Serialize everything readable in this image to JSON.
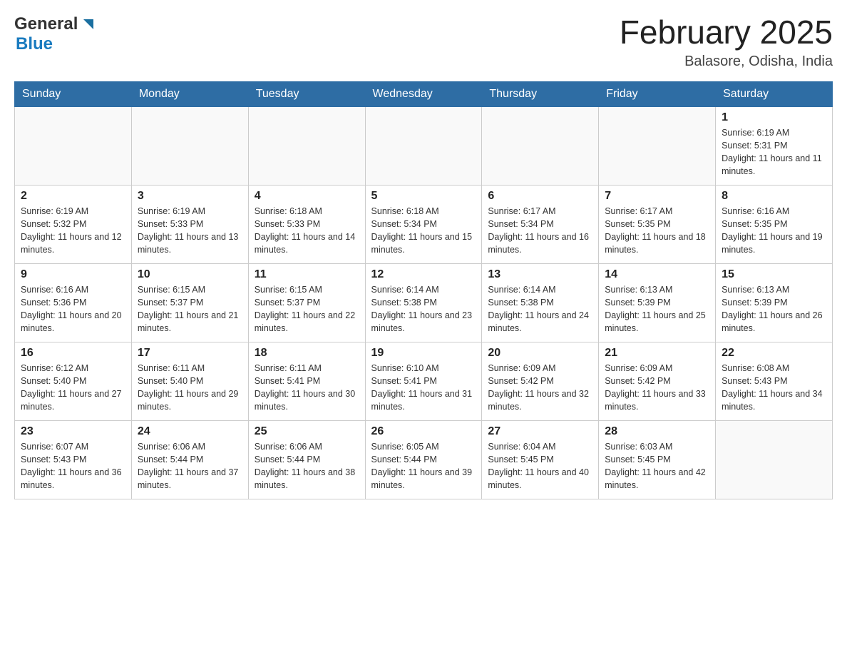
{
  "header": {
    "logo_general": "General",
    "logo_blue": "Blue",
    "month_title": "February 2025",
    "location": "Balasore, Odisha, India"
  },
  "days_of_week": [
    "Sunday",
    "Monday",
    "Tuesday",
    "Wednesday",
    "Thursday",
    "Friday",
    "Saturday"
  ],
  "weeks": [
    {
      "days": [
        {
          "number": "",
          "info": ""
        },
        {
          "number": "",
          "info": ""
        },
        {
          "number": "",
          "info": ""
        },
        {
          "number": "",
          "info": ""
        },
        {
          "number": "",
          "info": ""
        },
        {
          "number": "",
          "info": ""
        },
        {
          "number": "1",
          "info": "Sunrise: 6:19 AM\nSunset: 5:31 PM\nDaylight: 11 hours and 11 minutes."
        }
      ]
    },
    {
      "days": [
        {
          "number": "2",
          "info": "Sunrise: 6:19 AM\nSunset: 5:32 PM\nDaylight: 11 hours and 12 minutes."
        },
        {
          "number": "3",
          "info": "Sunrise: 6:19 AM\nSunset: 5:33 PM\nDaylight: 11 hours and 13 minutes."
        },
        {
          "number": "4",
          "info": "Sunrise: 6:18 AM\nSunset: 5:33 PM\nDaylight: 11 hours and 14 minutes."
        },
        {
          "number": "5",
          "info": "Sunrise: 6:18 AM\nSunset: 5:34 PM\nDaylight: 11 hours and 15 minutes."
        },
        {
          "number": "6",
          "info": "Sunrise: 6:17 AM\nSunset: 5:34 PM\nDaylight: 11 hours and 16 minutes."
        },
        {
          "number": "7",
          "info": "Sunrise: 6:17 AM\nSunset: 5:35 PM\nDaylight: 11 hours and 18 minutes."
        },
        {
          "number": "8",
          "info": "Sunrise: 6:16 AM\nSunset: 5:35 PM\nDaylight: 11 hours and 19 minutes."
        }
      ]
    },
    {
      "days": [
        {
          "number": "9",
          "info": "Sunrise: 6:16 AM\nSunset: 5:36 PM\nDaylight: 11 hours and 20 minutes."
        },
        {
          "number": "10",
          "info": "Sunrise: 6:15 AM\nSunset: 5:37 PM\nDaylight: 11 hours and 21 minutes."
        },
        {
          "number": "11",
          "info": "Sunrise: 6:15 AM\nSunset: 5:37 PM\nDaylight: 11 hours and 22 minutes."
        },
        {
          "number": "12",
          "info": "Sunrise: 6:14 AM\nSunset: 5:38 PM\nDaylight: 11 hours and 23 minutes."
        },
        {
          "number": "13",
          "info": "Sunrise: 6:14 AM\nSunset: 5:38 PM\nDaylight: 11 hours and 24 minutes."
        },
        {
          "number": "14",
          "info": "Sunrise: 6:13 AM\nSunset: 5:39 PM\nDaylight: 11 hours and 25 minutes."
        },
        {
          "number": "15",
          "info": "Sunrise: 6:13 AM\nSunset: 5:39 PM\nDaylight: 11 hours and 26 minutes."
        }
      ]
    },
    {
      "days": [
        {
          "number": "16",
          "info": "Sunrise: 6:12 AM\nSunset: 5:40 PM\nDaylight: 11 hours and 27 minutes."
        },
        {
          "number": "17",
          "info": "Sunrise: 6:11 AM\nSunset: 5:40 PM\nDaylight: 11 hours and 29 minutes."
        },
        {
          "number": "18",
          "info": "Sunrise: 6:11 AM\nSunset: 5:41 PM\nDaylight: 11 hours and 30 minutes."
        },
        {
          "number": "19",
          "info": "Sunrise: 6:10 AM\nSunset: 5:41 PM\nDaylight: 11 hours and 31 minutes."
        },
        {
          "number": "20",
          "info": "Sunrise: 6:09 AM\nSunset: 5:42 PM\nDaylight: 11 hours and 32 minutes."
        },
        {
          "number": "21",
          "info": "Sunrise: 6:09 AM\nSunset: 5:42 PM\nDaylight: 11 hours and 33 minutes."
        },
        {
          "number": "22",
          "info": "Sunrise: 6:08 AM\nSunset: 5:43 PM\nDaylight: 11 hours and 34 minutes."
        }
      ]
    },
    {
      "days": [
        {
          "number": "23",
          "info": "Sunrise: 6:07 AM\nSunset: 5:43 PM\nDaylight: 11 hours and 36 minutes."
        },
        {
          "number": "24",
          "info": "Sunrise: 6:06 AM\nSunset: 5:44 PM\nDaylight: 11 hours and 37 minutes."
        },
        {
          "number": "25",
          "info": "Sunrise: 6:06 AM\nSunset: 5:44 PM\nDaylight: 11 hours and 38 minutes."
        },
        {
          "number": "26",
          "info": "Sunrise: 6:05 AM\nSunset: 5:44 PM\nDaylight: 11 hours and 39 minutes."
        },
        {
          "number": "27",
          "info": "Sunrise: 6:04 AM\nSunset: 5:45 PM\nDaylight: 11 hours and 40 minutes."
        },
        {
          "number": "28",
          "info": "Sunrise: 6:03 AM\nSunset: 5:45 PM\nDaylight: 11 hours and 42 minutes."
        },
        {
          "number": "",
          "info": ""
        }
      ]
    }
  ]
}
